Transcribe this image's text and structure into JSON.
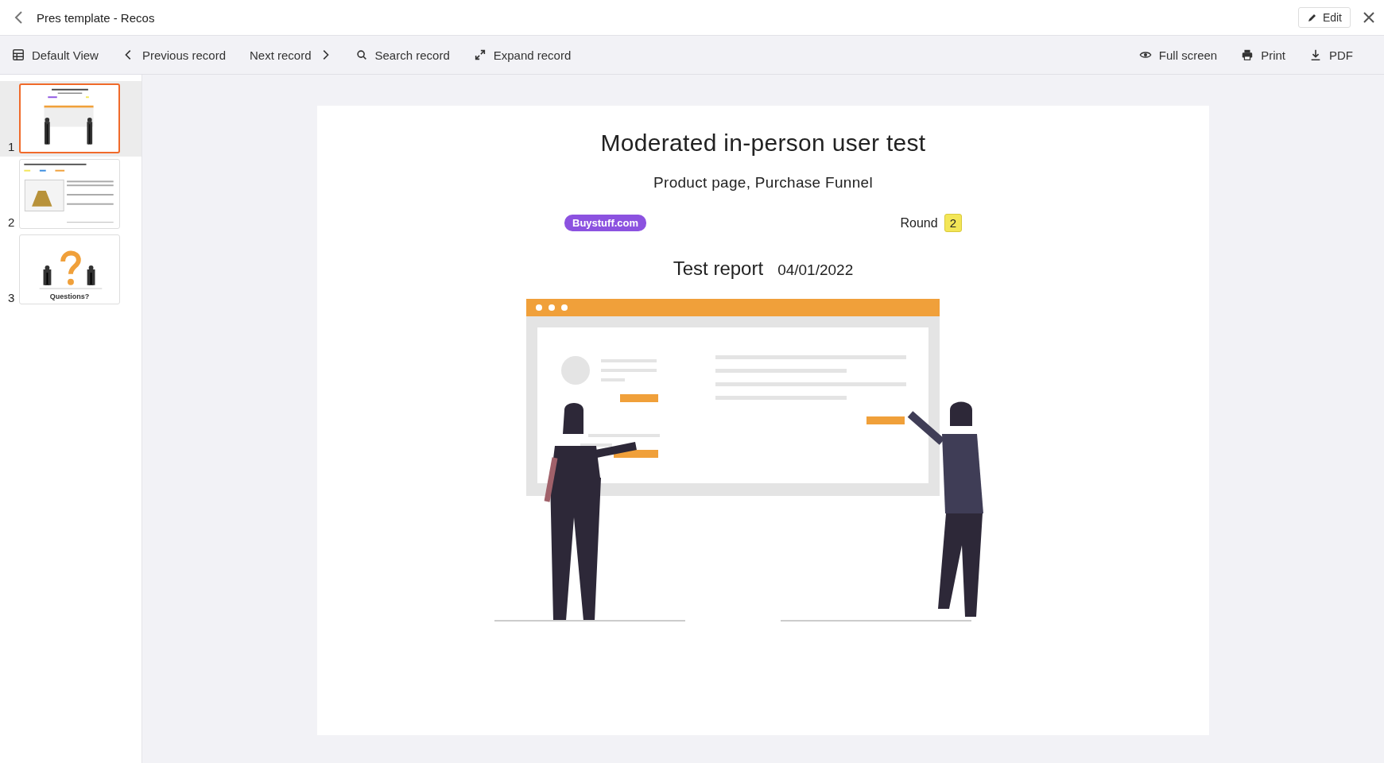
{
  "window": {
    "title": "Pres template - Recos",
    "edit_button": "Edit"
  },
  "toolbar": {
    "left": [
      {
        "label": "Default View",
        "kind": "grid"
      },
      {
        "label": "Previous record",
        "kind": "prev"
      },
      {
        "label": "Next record",
        "kind": "next"
      },
      {
        "label": "Search record",
        "kind": "search"
      },
      {
        "label": "Expand record",
        "kind": "expand"
      }
    ],
    "right": [
      {
        "label": "Full screen",
        "kind": "eye"
      },
      {
        "label": "Print",
        "kind": "print"
      },
      {
        "label": "PDF",
        "kind": "download"
      }
    ]
  },
  "slides": [
    {
      "number": "1",
      "selected": true,
      "kind": "title"
    },
    {
      "number": "2",
      "selected": false,
      "kind": "content"
    },
    {
      "number": "3",
      "selected": false,
      "kind": "questions",
      "caption": "Questions?"
    }
  ],
  "slide": {
    "title": "Moderated in-person user test",
    "subtitle": "Product page, Purchase Funnel",
    "site_tag": "Buystuff.com",
    "round_label": "Round",
    "round_value": "2",
    "report_label": "Test report",
    "report_date": "04/01/2022"
  }
}
